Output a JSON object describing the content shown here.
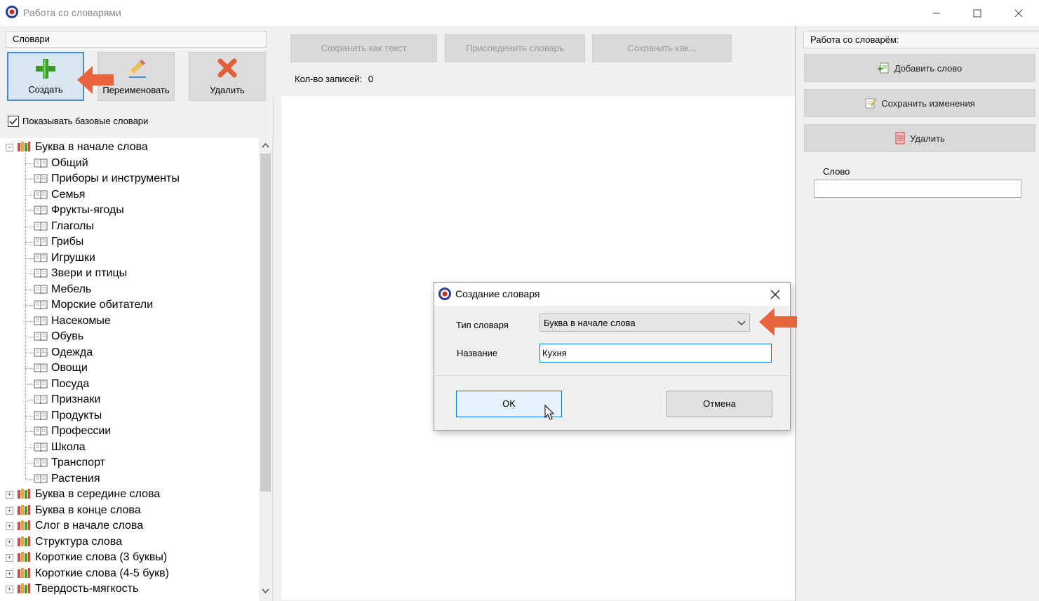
{
  "window": {
    "title": "Работа со словарями",
    "controls": [
      "minimize-icon",
      "maximize-icon",
      "close-icon"
    ]
  },
  "left_panel": {
    "header": "Словари",
    "buttons": [
      {
        "label": "Создать",
        "icon": "plus-icon",
        "color": "#4caf3c"
      },
      {
        "label": "Переименовать",
        "icon": "pencil-icon"
      },
      {
        "label": "Удалить",
        "icon": "x-icon",
        "color": "#e06040"
      }
    ],
    "show_base_checkbox": {
      "label": "Показывать базовые словари",
      "checked": true
    },
    "tree": [
      {
        "label": "Буква в начале слова",
        "expanded": true,
        "children": [
          "Общий",
          "Приборы и инструменты",
          "Семья",
          "Фрукты-ягоды",
          "Глаголы",
          "Грибы",
          "Игрушки",
          "Звери и птицы",
          "Мебель",
          "Морские обитатели",
          "Насекомые",
          "Обувь",
          "Одежда",
          "Овощи",
          "Посуда",
          "Признаки",
          "Продукты",
          "Профессии",
          "Школа",
          "Транспорт",
          "Растения"
        ]
      },
      {
        "label": "Буква в середине слова",
        "expanded": false
      },
      {
        "label": "Буква в конце слова",
        "expanded": false
      },
      {
        "label": "Слог в начале слова",
        "expanded": false
      },
      {
        "label": "Структура слова",
        "expanded": false
      },
      {
        "label": "Короткие слова (3 буквы)",
        "expanded": false
      },
      {
        "label": "Короткие слова (4-5 букв)",
        "expanded": false
      },
      {
        "label": "Твердость-мягкость",
        "expanded": false
      }
    ]
  },
  "middle_panel": {
    "buttons": [
      "Сохранить как текст",
      "Присоединить словарь",
      "Сохранить как..."
    ],
    "record_count_label": "Кол-во записей:",
    "record_count": "0"
  },
  "right_panel": {
    "header": "Работа со словарём:",
    "buttons": [
      {
        "label": "Добавить слово",
        "icon": "add-word-icon"
      },
      {
        "label": "Сохранить изменения",
        "icon": "save-edit-icon"
      },
      {
        "label": "Удалить",
        "icon": "delete-doc-icon"
      }
    ],
    "word_label": "Слово",
    "word_value": ""
  },
  "dialog": {
    "title": "Создание словаря",
    "type_label": "Тип словаря",
    "type_value": "Буква в начале слова",
    "name_label": "Название",
    "name_value": "Кухня",
    "ok": "OK",
    "cancel": "Отмена"
  },
  "annotation_color": "#e8643c"
}
